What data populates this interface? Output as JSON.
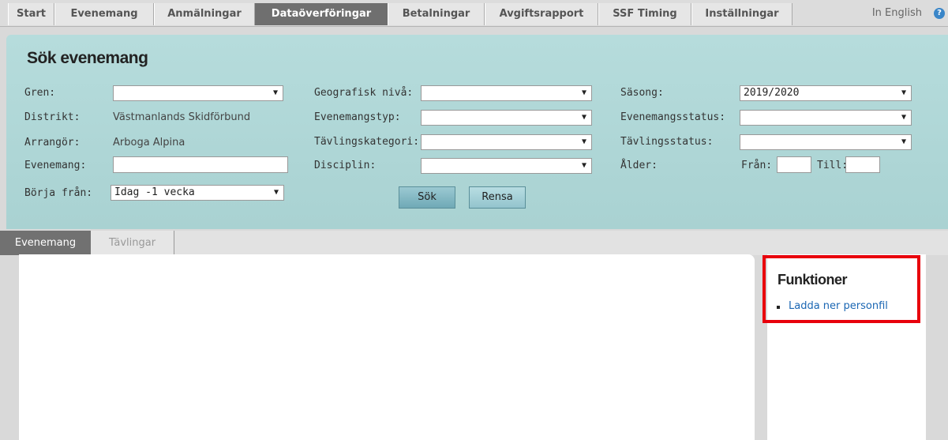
{
  "nav": {
    "tabs": [
      {
        "label": "Start",
        "active": false
      },
      {
        "label": "Evenemang",
        "active": false
      },
      {
        "label": "Anmälningar",
        "active": false
      },
      {
        "label": "Dataöverföringar",
        "active": true
      },
      {
        "label": "Betalningar",
        "active": false
      },
      {
        "label": "Avgiftsrapport",
        "active": false
      },
      {
        "label": "SSF Timing",
        "active": false
      },
      {
        "label": "Inställningar",
        "active": false
      }
    ],
    "language_link": "In English",
    "help_icon": "?"
  },
  "search": {
    "title": "Sök evenemang",
    "gren": {
      "label": "Gren:",
      "value": ""
    },
    "distrikt": {
      "label": "Distrikt:",
      "value": "Västmanlands Skidförbund"
    },
    "arrangor": {
      "label": "Arrangör:",
      "value": "Arboga Alpina"
    },
    "evenemang": {
      "label": "Evenemang:",
      "value": ""
    },
    "borja_fran": {
      "label": "Börja från:",
      "value": "Idag -1 vecka"
    },
    "geografisk_niva": {
      "label": "Geografisk nivå:",
      "value": ""
    },
    "evenemangstyp": {
      "label": "Evenemangstyp:",
      "value": ""
    },
    "tavlingskategori": {
      "label": "Tävlingskategori:",
      "value": ""
    },
    "disciplin": {
      "label": "Disciplin:",
      "value": ""
    },
    "sasong": {
      "label": "Säsong:",
      "value": "2019/2020"
    },
    "evenemangsstatus": {
      "label": "Evenemangsstatus:",
      "value": ""
    },
    "tavlingsstatus": {
      "label": "Tävlingsstatus:",
      "value": ""
    },
    "alder": {
      "label": "Ålder:",
      "fran_label": "Från:",
      "till_label": "Till:"
    },
    "search_button": "Sök",
    "clear_button": "Rensa",
    "dropdown_arrow": "▼"
  },
  "subtabs": [
    {
      "label": "Evenemang",
      "active": true
    },
    {
      "label": "Tävlingar",
      "active": false
    }
  ],
  "functions": {
    "title": "Funktioner",
    "items": [
      {
        "label": "Ladda ner personfil"
      }
    ]
  },
  "colors": {
    "panel": "#b1d8d8",
    "active_tab": "#6f6f6f",
    "highlight": "#e8000c",
    "link": "#1a66b3"
  }
}
